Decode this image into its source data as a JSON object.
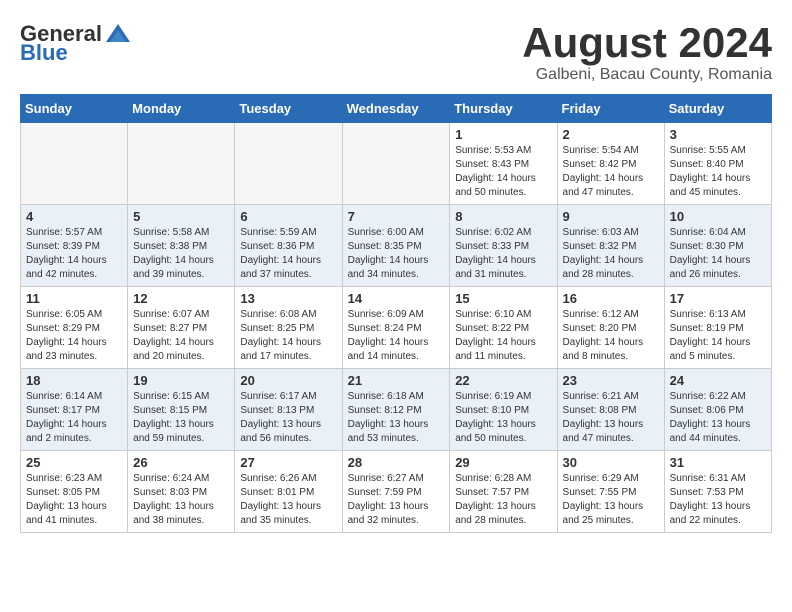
{
  "header": {
    "logo_general": "General",
    "logo_blue": "Blue",
    "month_year": "August 2024",
    "location": "Galbeni, Bacau County, Romania"
  },
  "weekdays": [
    "Sunday",
    "Monday",
    "Tuesday",
    "Wednesday",
    "Thursday",
    "Friday",
    "Saturday"
  ],
  "weeks": [
    [
      {
        "day": "",
        "info": ""
      },
      {
        "day": "",
        "info": ""
      },
      {
        "day": "",
        "info": ""
      },
      {
        "day": "",
        "info": ""
      },
      {
        "day": "1",
        "info": "Sunrise: 5:53 AM\nSunset: 8:43 PM\nDaylight: 14 hours\nand 50 minutes."
      },
      {
        "day": "2",
        "info": "Sunrise: 5:54 AM\nSunset: 8:42 PM\nDaylight: 14 hours\nand 47 minutes."
      },
      {
        "day": "3",
        "info": "Sunrise: 5:55 AM\nSunset: 8:40 PM\nDaylight: 14 hours\nand 45 minutes."
      }
    ],
    [
      {
        "day": "4",
        "info": "Sunrise: 5:57 AM\nSunset: 8:39 PM\nDaylight: 14 hours\nand 42 minutes."
      },
      {
        "day": "5",
        "info": "Sunrise: 5:58 AM\nSunset: 8:38 PM\nDaylight: 14 hours\nand 39 minutes."
      },
      {
        "day": "6",
        "info": "Sunrise: 5:59 AM\nSunset: 8:36 PM\nDaylight: 14 hours\nand 37 minutes."
      },
      {
        "day": "7",
        "info": "Sunrise: 6:00 AM\nSunset: 8:35 PM\nDaylight: 14 hours\nand 34 minutes."
      },
      {
        "day": "8",
        "info": "Sunrise: 6:02 AM\nSunset: 8:33 PM\nDaylight: 14 hours\nand 31 minutes."
      },
      {
        "day": "9",
        "info": "Sunrise: 6:03 AM\nSunset: 8:32 PM\nDaylight: 14 hours\nand 28 minutes."
      },
      {
        "day": "10",
        "info": "Sunrise: 6:04 AM\nSunset: 8:30 PM\nDaylight: 14 hours\nand 26 minutes."
      }
    ],
    [
      {
        "day": "11",
        "info": "Sunrise: 6:05 AM\nSunset: 8:29 PM\nDaylight: 14 hours\nand 23 minutes."
      },
      {
        "day": "12",
        "info": "Sunrise: 6:07 AM\nSunset: 8:27 PM\nDaylight: 14 hours\nand 20 minutes."
      },
      {
        "day": "13",
        "info": "Sunrise: 6:08 AM\nSunset: 8:25 PM\nDaylight: 14 hours\nand 17 minutes."
      },
      {
        "day": "14",
        "info": "Sunrise: 6:09 AM\nSunset: 8:24 PM\nDaylight: 14 hours\nand 14 minutes."
      },
      {
        "day": "15",
        "info": "Sunrise: 6:10 AM\nSunset: 8:22 PM\nDaylight: 14 hours\nand 11 minutes."
      },
      {
        "day": "16",
        "info": "Sunrise: 6:12 AM\nSunset: 8:20 PM\nDaylight: 14 hours\nand 8 minutes."
      },
      {
        "day": "17",
        "info": "Sunrise: 6:13 AM\nSunset: 8:19 PM\nDaylight: 14 hours\nand 5 minutes."
      }
    ],
    [
      {
        "day": "18",
        "info": "Sunrise: 6:14 AM\nSunset: 8:17 PM\nDaylight: 14 hours\nand 2 minutes."
      },
      {
        "day": "19",
        "info": "Sunrise: 6:15 AM\nSunset: 8:15 PM\nDaylight: 13 hours\nand 59 minutes."
      },
      {
        "day": "20",
        "info": "Sunrise: 6:17 AM\nSunset: 8:13 PM\nDaylight: 13 hours\nand 56 minutes."
      },
      {
        "day": "21",
        "info": "Sunrise: 6:18 AM\nSunset: 8:12 PM\nDaylight: 13 hours\nand 53 minutes."
      },
      {
        "day": "22",
        "info": "Sunrise: 6:19 AM\nSunset: 8:10 PM\nDaylight: 13 hours\nand 50 minutes."
      },
      {
        "day": "23",
        "info": "Sunrise: 6:21 AM\nSunset: 8:08 PM\nDaylight: 13 hours\nand 47 minutes."
      },
      {
        "day": "24",
        "info": "Sunrise: 6:22 AM\nSunset: 8:06 PM\nDaylight: 13 hours\nand 44 minutes."
      }
    ],
    [
      {
        "day": "25",
        "info": "Sunrise: 6:23 AM\nSunset: 8:05 PM\nDaylight: 13 hours\nand 41 minutes."
      },
      {
        "day": "26",
        "info": "Sunrise: 6:24 AM\nSunset: 8:03 PM\nDaylight: 13 hours\nand 38 minutes."
      },
      {
        "day": "27",
        "info": "Sunrise: 6:26 AM\nSunset: 8:01 PM\nDaylight: 13 hours\nand 35 minutes."
      },
      {
        "day": "28",
        "info": "Sunrise: 6:27 AM\nSunset: 7:59 PM\nDaylight: 13 hours\nand 32 minutes."
      },
      {
        "day": "29",
        "info": "Sunrise: 6:28 AM\nSunset: 7:57 PM\nDaylight: 13 hours\nand 28 minutes."
      },
      {
        "day": "30",
        "info": "Sunrise: 6:29 AM\nSunset: 7:55 PM\nDaylight: 13 hours\nand 25 minutes."
      },
      {
        "day": "31",
        "info": "Sunrise: 6:31 AM\nSunset: 7:53 PM\nDaylight: 13 hours\nand 22 minutes."
      }
    ]
  ]
}
